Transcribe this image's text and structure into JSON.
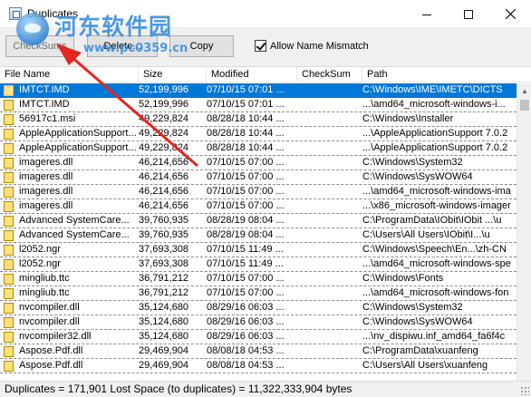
{
  "window": {
    "title": "Duplicates",
    "minimize_icon": "minimize-icon",
    "maximize_icon": "maximize-icon",
    "close_icon": "close-icon"
  },
  "watermark": {
    "title": "河东软件园",
    "url": "www.pc0359.cn"
  },
  "toolbar": {
    "checksums_label": "CheckSums",
    "delete_label": "Delete...",
    "copy_label": "Copy",
    "allow_name_mismatch_label": "Allow Name Mismatch",
    "allow_name_mismatch_checked": true
  },
  "columns": [
    "File Name",
    "Size",
    "Modified",
    "CheckSum",
    "Path"
  ],
  "rows": [
    {
      "name": "IMTCT.IMD",
      "size": "52,199,996",
      "modified": "07/10/15 07:01 ...",
      "checksum": "",
      "path": "C:\\Windows\\IME\\IMETC\\DICTS",
      "selected": true
    },
    {
      "name": "IMTCT.IMD",
      "size": "52,199,996",
      "modified": "07/10/15 07:01 ...",
      "checksum": "",
      "path": "...\\amd64_microsoft-windows-i..."
    },
    {
      "name": "56917c1.msi",
      "size": "49,229,824",
      "modified": "08/28/18 10:44 ...",
      "checksum": "",
      "path": "C:\\Windows\\Installer"
    },
    {
      "name": "AppleApplicationSupport...",
      "size": "49,229,824",
      "modified": "08/28/18 10:44 ...",
      "checksum": "",
      "path": "...\\AppleApplicationSupport 7.0.2"
    },
    {
      "name": "AppleApplicationSupport...",
      "size": "49,229,824",
      "modified": "08/28/18 10:44 ...",
      "checksum": "",
      "path": "...\\AppleApplicationSupport 7.0.2"
    },
    {
      "name": "imageres.dll",
      "size": "46,214,656",
      "modified": "07/10/15 07:00 ...",
      "checksum": "",
      "path": "C:\\Windows\\System32"
    },
    {
      "name": "imageres.dll",
      "size": "46,214,656",
      "modified": "07/10/15 07:00 ...",
      "checksum": "",
      "path": "C:\\Windows\\SysWOW64"
    },
    {
      "name": "imageres.dll",
      "size": "46,214,656",
      "modified": "07/10/15 07:00 ...",
      "checksum": "",
      "path": "...\\amd64_microsoft-windows-ima"
    },
    {
      "name": "imageres.dll",
      "size": "46,214,656",
      "modified": "07/10/15 07:00 ...",
      "checksum": "",
      "path": "...\\x86_microsoft-windows-imager"
    },
    {
      "name": "Advanced SystemCare...",
      "size": "39,760,935",
      "modified": "08/28/19 08:04 ...",
      "checksum": "",
      "path": "C:\\ProgramData\\IObit\\IObit ...\\u"
    },
    {
      "name": "Advanced SystemCare...",
      "size": "39,760,935",
      "modified": "08/28/19 08:04 ...",
      "checksum": "",
      "path": "C:\\Users\\All Users\\IObit\\I...\\u"
    },
    {
      "name": "l2052.ngr",
      "size": "37,693,308",
      "modified": "07/10/15 11:49 ...",
      "checksum": "",
      "path": "C:\\Windows\\Speech\\En...\\zh-CN"
    },
    {
      "name": "l2052.ngr",
      "size": "37,693,308",
      "modified": "07/10/15 11:49 ...",
      "checksum": "",
      "path": "...\\amd64_microsoft-windows-spe"
    },
    {
      "name": "mingliub.ttc",
      "size": "36,791,212",
      "modified": "07/10/15 07:00 ...",
      "checksum": "",
      "path": "C:\\Windows\\Fonts"
    },
    {
      "name": "mingliub.ttc",
      "size": "36,791,212",
      "modified": "07/10/15 07:00 ...",
      "checksum": "",
      "path": "...\\amd64_microsoft-windows-fon"
    },
    {
      "name": "nvcompiler.dll",
      "size": "35,124,680",
      "modified": "08/29/16 06:03 ...",
      "checksum": "",
      "path": "C:\\Windows\\System32"
    },
    {
      "name": "nvcompiler.dll",
      "size": "35,124,680",
      "modified": "08/29/16 06:03 ...",
      "checksum": "",
      "path": "C:\\Windows\\SysWOW64"
    },
    {
      "name": "nvcompiler32.dll",
      "size": "35,124,680",
      "modified": "08/29/16 06:03 ...",
      "checksum": "",
      "path": "...\\nv_dispiwu.inf_amd64_fa6f4c"
    },
    {
      "name": "Aspose.Pdf.dll",
      "size": "29,469,904",
      "modified": "08/08/18 04:53 ...",
      "checksum": "",
      "path": "C:\\ProgramData\\xuanfeng"
    },
    {
      "name": "Aspose.Pdf.dll",
      "size": "29,469,904",
      "modified": "08/08/18 04:53 ...",
      "checksum": "",
      "path": "C:\\Users\\All Users\\xuanfeng"
    }
  ],
  "status": {
    "text": "Duplicates = 171,901  Lost Space (to duplicates) = 11,322,333,904 bytes"
  }
}
